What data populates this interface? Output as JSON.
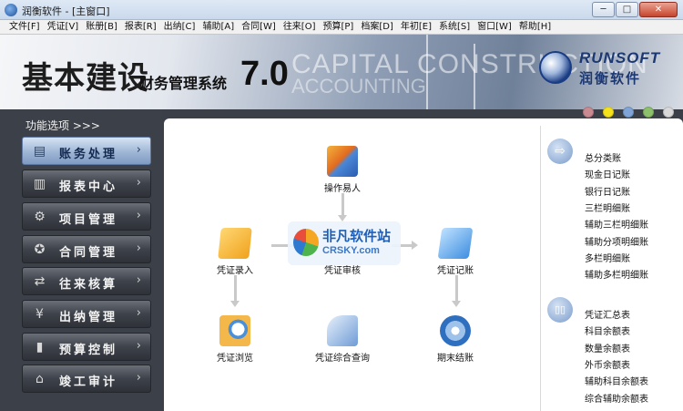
{
  "window": {
    "title": "润衡软件 - [主窗口]",
    "buttons": {
      "minimize": "─",
      "maximize": "□",
      "close": "✕"
    }
  },
  "menu": [
    "文件[F]",
    "凭证[V]",
    "账册[B]",
    "报表[R]",
    "出纳[C]",
    "辅助[A]",
    "合同[W]",
    "往来[O]",
    "预算[P]",
    "档案[D]",
    "年初[E]",
    "系统[S]",
    "窗口[W]",
    "帮助[H]"
  ],
  "banner": {
    "title_cn": "基本建设",
    "subtitle": "财务管理系统",
    "version": "7.0",
    "english_line1": "CAPITAL CONSTRUCTION",
    "english_line2": "ACCOUNTING",
    "brand_en": "RUNSOFT",
    "brand_cn": "润衡软件"
  },
  "sidebar": {
    "title": "功能选项 >>>",
    "items": [
      {
        "label": "账务处理",
        "icon": "ledger-icon",
        "glyph": "▤",
        "active": true
      },
      {
        "label": "报表中心",
        "icon": "report-icon",
        "glyph": "▥",
        "active": false
      },
      {
        "label": "项目管理",
        "icon": "gears-icon",
        "glyph": "⚙",
        "active": false
      },
      {
        "label": "合同管理",
        "icon": "contract-icon",
        "glyph": "✪",
        "active": false
      },
      {
        "label": "往来核算",
        "icon": "exchange-icon",
        "glyph": "⇄",
        "active": false
      },
      {
        "label": "出纳管理",
        "icon": "cashier-icon",
        "glyph": "¥",
        "active": false
      },
      {
        "label": "预算控制",
        "icon": "budget-icon",
        "glyph": "▮",
        "active": false
      },
      {
        "label": "竣工审计",
        "icon": "home-icon",
        "glyph": "⌂",
        "active": false
      }
    ],
    "arrow": "›"
  },
  "theme_dots": [
    "#c98a92",
    "#f6e21b",
    "#7fa5d8",
    "#8cc06a",
    "#d8d8d8"
  ],
  "flow": {
    "operator": "操作易人",
    "voucher_entry": "凭证录入",
    "voucher_audit": "凭证审核",
    "voucher_post": "凭证记账",
    "voucher_browse": "凭证浏览",
    "voucher_query": "凭证综合查询",
    "period_close": "期末结账"
  },
  "watermark": {
    "cn": "非凡软件站",
    "en": "CRSKY.com"
  },
  "ledgers": {
    "icon_glyph": "⇨",
    "items": [
      "总分类账",
      "现金日记账",
      "银行日记账",
      "三栏明细账",
      "辅助三栏明细账",
      "辅助分项明细账",
      "多栏明细账",
      "辅助多栏明细账"
    ]
  },
  "reports": {
    "icon_glyph": "▯▯",
    "items": [
      "凭证汇总表",
      "科目余额表",
      "数量余额表",
      "外币余额表",
      "辅助科目余额表",
      "综合辅助余额表"
    ]
  }
}
